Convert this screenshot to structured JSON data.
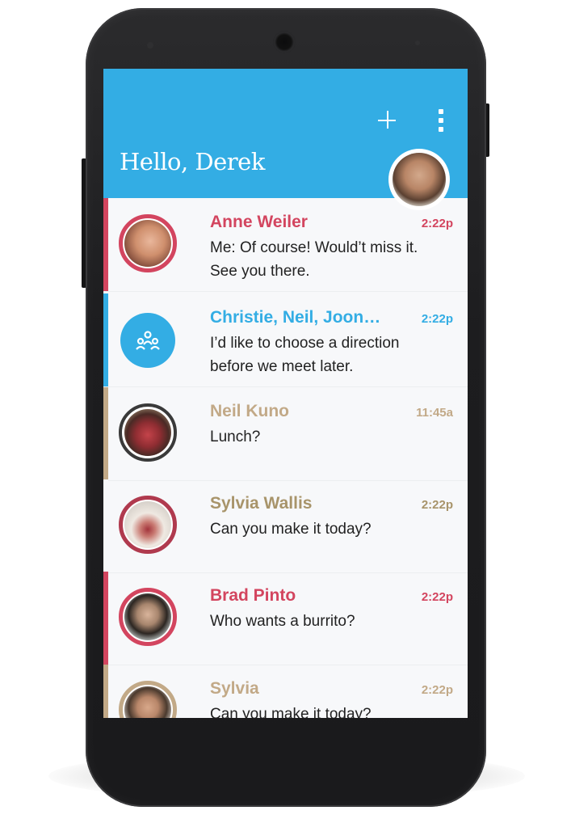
{
  "header": {
    "greeting": "Hello, Derek",
    "add_icon": "plus-icon",
    "menu_icon": "more-vert-icon",
    "background_color": "#33ade4"
  },
  "conversations": [
    {
      "name": "Anne Weiler",
      "time": "2:22p",
      "message": "Me: Of course! Would’t miss it. See you there.",
      "color": "#d3455f",
      "avatar": "photo"
    },
    {
      "name": "Christie, Neil, Joon…",
      "time": "2:22p",
      "message": "I’d like to choose a direction before we meet later.",
      "color": "#33ade4",
      "avatar": "group-icon"
    },
    {
      "name": "Neil Kuno",
      "time": "11:45a",
      "message": "Lunch?",
      "color": "#c2a987",
      "avatar": "photo"
    },
    {
      "name": "Sylvia Wallis",
      "time": "2:22p",
      "message": "Can you make it today?",
      "color": "#a8946a",
      "avatar": "photo"
    },
    {
      "name": "Brad Pinto",
      "time": "2:22p",
      "message": "Who wants a burrito?",
      "color": "#d3455f",
      "avatar": "photo"
    },
    {
      "name": "Sylvia",
      "time": "2:22p",
      "message": "Can you make it today?",
      "color": "#c2a987",
      "avatar": "photo"
    }
  ]
}
